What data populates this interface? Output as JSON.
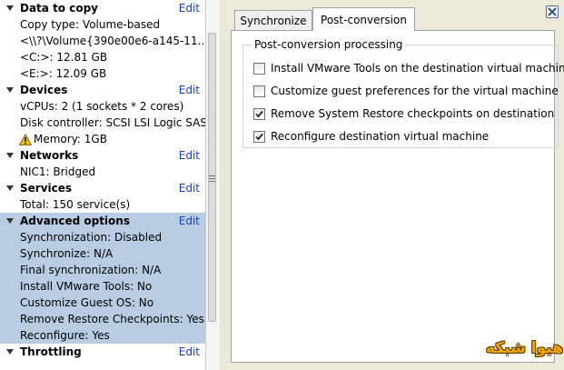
{
  "left_panel": {
    "edit_label": "Edit",
    "sections": [
      {
        "title": "Data to copy",
        "rows": [
          "Copy type: Volume-based",
          "<\\\\?\\Volume{390e00e6-a145-11...",
          "<C:>: 12.81 GB",
          "<E:>: 12.09 GB"
        ]
      },
      {
        "title": "Devices",
        "rows": [
          "vCPUs: 2 (1 sockets * 2 cores)",
          "Disk controller: SCSI LSI Logic SAS",
          "Memory: 1GB"
        ],
        "warning_row_index": 2,
        "warning_icon": "warning-triangle-icon",
        "warning_color": "#f2c200"
      },
      {
        "title": "Networks",
        "rows": [
          "NIC1: Bridged"
        ]
      },
      {
        "title": "Services",
        "rows": [
          "Total: 150 service(s)"
        ]
      },
      {
        "title": "Advanced options",
        "selected": true,
        "rows": [
          "Synchronization: Disabled",
          "Synchronize: N/A",
          "Final synchronization: N/A",
          "Install VMware Tools: No",
          "Customize Guest OS: No",
          "Remove Restore Checkpoints: Yes",
          "Reconfigure: Yes"
        ]
      },
      {
        "title": "Throttling",
        "rows": []
      }
    ]
  },
  "right_panel": {
    "tabs": [
      {
        "label": "Synchronize",
        "active": false
      },
      {
        "label": "Post-conversion",
        "active": true
      }
    ],
    "group_title": "Post-conversion processing",
    "options": [
      {
        "label": "Install VMware Tools on the destination virtual machine",
        "checked": false
      },
      {
        "label": "Customize guest preferences for the virtual machine",
        "checked": false
      },
      {
        "label": "Remove System Restore checkpoints on destination",
        "checked": true
      },
      {
        "label": "Reconfigure destination virtual machine",
        "checked": true
      }
    ],
    "close_icon": "close-icon"
  },
  "watermark": {
    "text": "هیوا شبکه"
  },
  "colors": {
    "selected_section_bg": "#b8cde4",
    "link": "#1a3cc8",
    "right_panel_bg": "#ece9d8",
    "watermark": "#f2a800"
  }
}
